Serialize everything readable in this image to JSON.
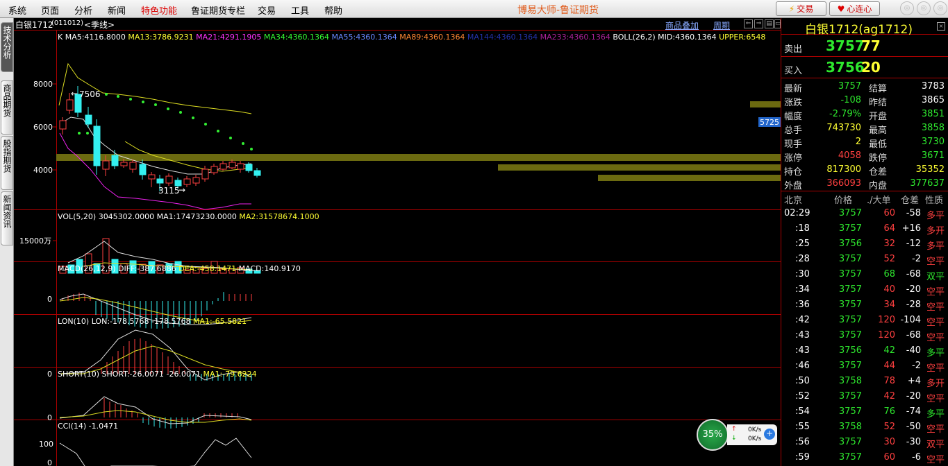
{
  "menu": [
    "系统",
    "页面",
    "分析",
    "新闻",
    "特色功能",
    "鲁证期货专栏",
    "交易",
    "工具",
    "帮助"
  ],
  "app_title": "博易大师-鲁证期货",
  "trade_btn": "交易",
  "xinlian_btn": "心连心",
  "sidebar_tabs": [
    "技术分析",
    "商品期货",
    "股指期货",
    "新闻资讯"
  ],
  "chart": {
    "title": "白银1712",
    "code": "(011012)",
    "period": "<季线>",
    "overlay_btn": "商品叠加",
    "cycle_btn": "周期",
    "right_price_label": "5725",
    "main_legend": [
      {
        "text": "K",
        "color": "#ffffff"
      },
      {
        "text": "MA5:4116.8000",
        "color": "#ffffff"
      },
      {
        "text": "MA13:3786.9231",
        "color": "#ffff33"
      },
      {
        "text": "MA21:4291.1905",
        "color": "#ff33ff"
      },
      {
        "text": "MA34:4360.1364",
        "color": "#33ff33"
      },
      {
        "text": "MA55:4360.1364",
        "color": "#6688ff"
      },
      {
        "text": "MA89:4360.1364",
        "color": "#ff8833"
      },
      {
        "text": "MA144:4360.1364",
        "color": "#2233aa"
      },
      {
        "text": "MA233:4360.1364",
        "color": "#aa2299"
      },
      {
        "text": "BOLL(26,2) MID:4360.1364",
        "color": "#ffffff"
      },
      {
        "text": "UPPER:6548",
        "color": "#ffff33"
      }
    ],
    "main_y_ticks": [
      "8000",
      "6000",
      "4000"
    ],
    "high_marker": "7506",
    "low_marker": "3115",
    "vol_legend": [
      {
        "text": "VOL(5,20) 3045302.0000",
        "color": "#ffffff"
      },
      {
        "text": "MA1:17473230.0000",
        "color": "#ffffff"
      },
      {
        "text": "MA2:31578674.1000",
        "color": "#ffff33"
      }
    ],
    "vol_y_tick": "15000万",
    "macd_legend": [
      {
        "text": "MACD(26,12,9)",
        "color": "#ffffff"
      },
      {
        "text": "DIFF:-387.6886",
        "color": "#ffffff"
      },
      {
        "text": "DEA:-458.1471",
        "color": "#ffff33"
      },
      {
        "text": "MACD:140.9170",
        "color": "#ffffff"
      }
    ],
    "lon_legend": [
      {
        "text": "LON(10) LON:-178.5768",
        "color": "#ffffff"
      },
      {
        "text": "-178.5768",
        "color": "#ffffff"
      },
      {
        "text": "MA1:-65.5821",
        "color": "#ffff33"
      }
    ],
    "short_legend": [
      {
        "text": "SHORT(10) SHORT:-26.0071",
        "color": "#ffffff"
      },
      {
        "text": "-26.0071",
        "color": "#ffffff"
      },
      {
        "text": "MA1:-79.6224",
        "color": "#ffff33"
      }
    ],
    "cci_legend": [
      {
        "text": "CCI(14) -1.0471",
        "color": "#ffffff"
      }
    ],
    "zero_label": "0",
    "cci_ticks": [
      "100",
      "0"
    ],
    "net_percent": "35%",
    "net_up": "0K/s",
    "net_down": "0K/s"
  },
  "quote": {
    "title": "白银1712(ag1712)",
    "sell_label": "卖出",
    "sell_price": "3757",
    "sell_vol": "77",
    "buy_label": "买入",
    "buy_price": "3756",
    "buy_vol": "20",
    "stats": [
      [
        "最新",
        "3757",
        "green",
        "结算",
        "3783",
        "white"
      ],
      [
        "涨跌",
        "-108",
        "green",
        "昨结",
        "3865",
        "white"
      ],
      [
        "幅度",
        "-2.79%",
        "green",
        "开盘",
        "3851",
        "green"
      ],
      [
        "总手",
        "743730",
        "yellow",
        "最高",
        "3858",
        "green"
      ],
      [
        "现手",
        "2",
        "yellow",
        "最低",
        "3730",
        "green"
      ],
      [
        "涨停",
        "4058",
        "red",
        "跌停",
        "3671",
        "green"
      ],
      [
        "持仓",
        "817300",
        "yellow",
        "仓差",
        "35352",
        "yellow"
      ],
      [
        "外盘",
        "366093",
        "red",
        "内盘",
        "377637",
        "green"
      ]
    ],
    "tick_headers": [
      "北京",
      "价格",
      "./大单",
      "仓差",
      "性质"
    ],
    "ticks": [
      [
        "02:29",
        "3757",
        "60",
        "-58",
        "多平",
        "red"
      ],
      [
        ":18",
        "3757",
        "64",
        "+16",
        "多开",
        "red"
      ],
      [
        ":25",
        "3756",
        "32",
        "-12",
        "多平",
        "red"
      ],
      [
        ":28",
        "3757",
        "52",
        "-2",
        "空平",
        "red"
      ],
      [
        ":30",
        "3757",
        "68",
        "-68",
        "双平",
        "green"
      ],
      [
        ":34",
        "3757",
        "40",
        "-20",
        "空平",
        "red"
      ],
      [
        ":36",
        "3757",
        "34",
        "-28",
        "空平",
        "red"
      ],
      [
        ":42",
        "3757",
        "120",
        "-104",
        "空平",
        "red"
      ],
      [
        ":43",
        "3757",
        "120",
        "-68",
        "空平",
        "red"
      ],
      [
        ":43",
        "3756",
        "42",
        "-40",
        "多平",
        "green"
      ],
      [
        ":46",
        "3757",
        "44",
        "-2",
        "空平",
        "red"
      ],
      [
        ":50",
        "3758",
        "78",
        "+4",
        "多开",
        "red"
      ],
      [
        ":52",
        "3757",
        "42",
        "-20",
        "空平",
        "red"
      ],
      [
        ":54",
        "3757",
        "76",
        "-74",
        "多平",
        "green"
      ],
      [
        ":55",
        "3758",
        "52",
        "-50",
        "空平",
        "red"
      ],
      [
        ":56",
        "3757",
        "30",
        "-30",
        "双平",
        "red"
      ],
      [
        ":59",
        "3757",
        "60",
        "-6",
        "空平",
        "red"
      ]
    ]
  }
}
